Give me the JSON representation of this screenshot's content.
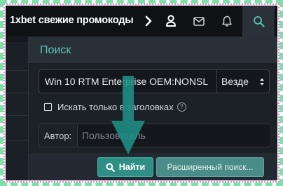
{
  "topbar": {
    "title": "1xbet свежие промокоды",
    "icons": [
      "chevron-right-icon",
      "user-icon",
      "mail-icon",
      "bell-icon",
      "search-icon"
    ]
  },
  "search_popup": {
    "title": "Поиск",
    "query_value": "Win 10 RTM Enterprise OEM:NONSL",
    "scope_value": "Везде",
    "titles_only_label": "Искать только в заголовках",
    "author_label": "Автор:",
    "author_placeholder": "Пользователь",
    "search_button_label": "Найти",
    "advanced_button_label": "Расширенный поиск..."
  },
  "colors": {
    "accent": "#5cc6b8",
    "primary_button": "#2f8f85",
    "arrow": "#1f8e86"
  }
}
